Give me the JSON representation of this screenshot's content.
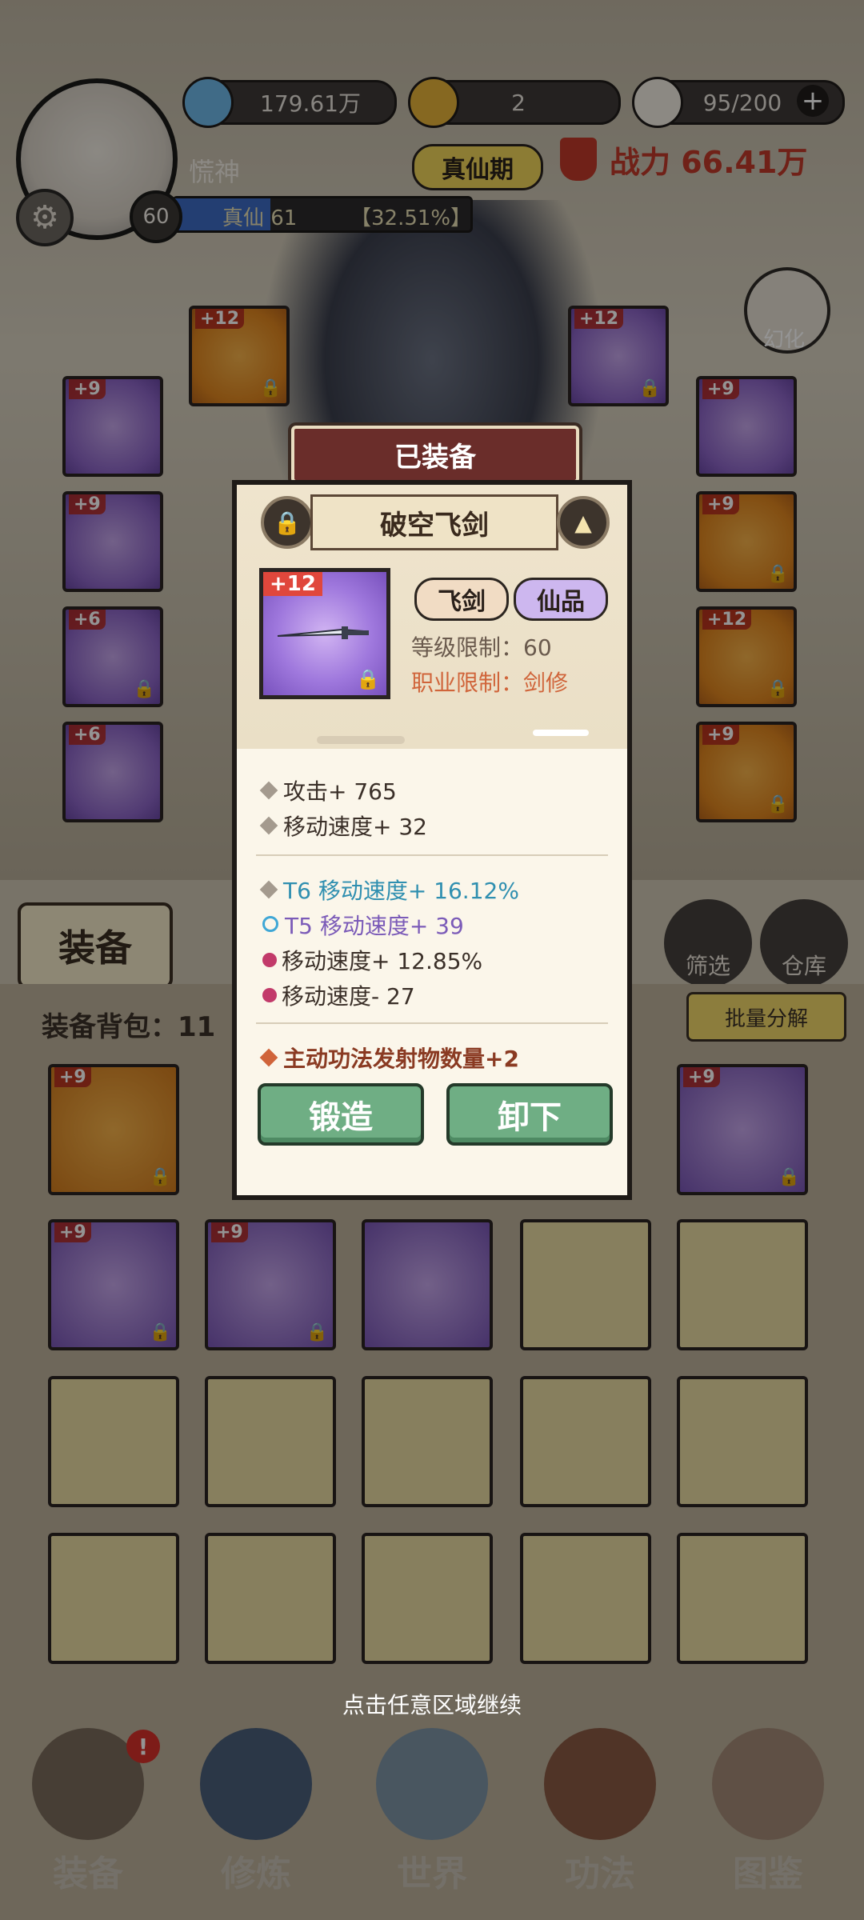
{
  "top_bar": {
    "spirit_stones": "179.61万",
    "gold": "2",
    "stamina": "95/200",
    "player_name": "慌神",
    "realm_badge": "真仙期",
    "power_label": "战力 66.41万",
    "level": "60",
    "exp_text": "真仙 61",
    "exp_percent_text": "【32.51%】",
    "exp_fraction": 0.3251
  },
  "scene": {
    "transform_label": "幻化",
    "left_slots": [
      "+9",
      "+9",
      "+6",
      "+6"
    ],
    "right_slots": [
      "+9",
      "+9",
      "+12",
      "+9"
    ],
    "weapon_slots": [
      "+12",
      "+12"
    ]
  },
  "tabs": {
    "equip_tab": "装备",
    "filter_label": "筛选",
    "warehouse_label": "仓库",
    "bag_title": "装备背包：11",
    "batch_decompose": "批量分解"
  },
  "bag": {
    "row1": [
      "+9",
      "",
      "",
      "",
      "+9"
    ],
    "row2": [
      "+9",
      "+9",
      "",
      "",
      ""
    ]
  },
  "popup": {
    "title": "已装备",
    "item_name": "破空飞剑",
    "enhance": "+12",
    "type_tag": "飞剑",
    "quality_tag": "仙品",
    "level_req": "等级限制：60",
    "class_req": "职业限制：剑修",
    "base_stats": [
      "攻击+ 765",
      "移动速度+ 32"
    ],
    "extra_stats": [
      {
        "text": "T6 移动速度+ 16.12%",
        "color": "#2f8fb0"
      },
      {
        "text": "T5 移动速度+ 39",
        "color": "#7b5bb8"
      },
      {
        "text": "移动速度+ 12.85%",
        "color": "#3a2f28"
      },
      {
        "text": "移动速度- 27",
        "color": "#3a2f28"
      }
    ],
    "special_stat": "主动功法发射物数量+2",
    "forge_button": "锻造",
    "unequip_button": "卸下"
  },
  "continue_hint": "点击任意区域继续",
  "bottom_nav": {
    "items": [
      "装备",
      "修炼",
      "世界",
      "功法",
      "图鉴"
    ]
  },
  "colors": {
    "popup_bg": "#fbf6ea",
    "title_bg": "#6a2d2a",
    "action_green": "#6fae84",
    "purple_quality": "#9f78dd",
    "power_red": "#c13a2a"
  }
}
